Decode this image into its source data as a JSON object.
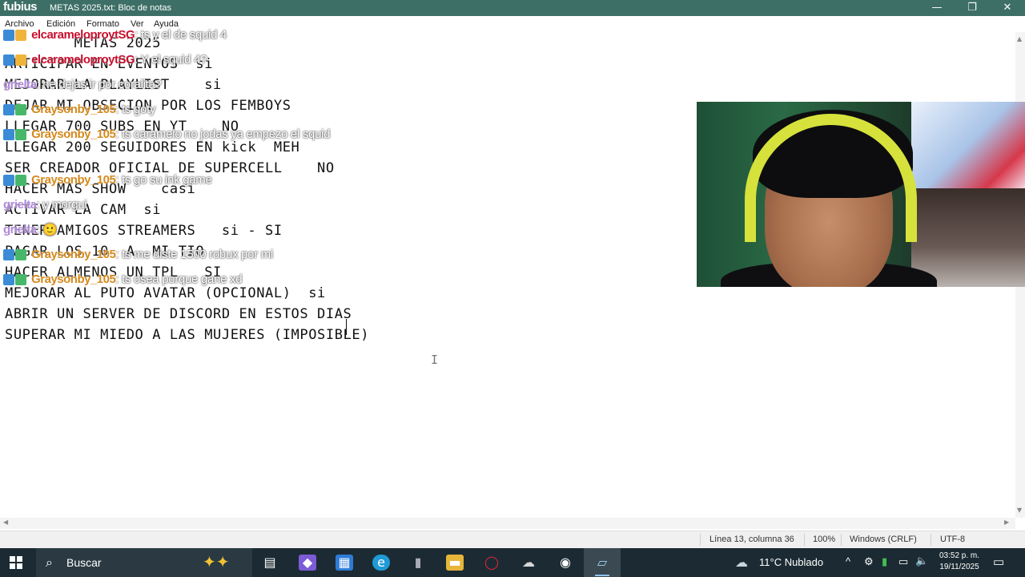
{
  "window": {
    "overlay_logo": "fubius",
    "title": "METAS 2025.txt: Bloc de notas",
    "controls": {
      "minimize": "—",
      "maximize": "❐",
      "close": "✕"
    }
  },
  "menu": [
    "Archivo",
    "Edición",
    "Formato",
    "Ver",
    "Ayuda"
  ],
  "document": {
    "lines": [
      "        METAS 2025",
      "ARTICIPAR EN EVENTOS  si",
      "MEJORAR LA PLAYLIST    si",
      "DEJAR MI OBSECION POR LOS FEMBOYS",
      "LLEGAR 700 SUBS EN YT    NO",
      "LLEGAR 200 SEGUIDORES EN kick  MEH",
      "SER CREADOR OFICIAL DE SUPERCELL    NO",
      "HACER MAS SHOW    casi",
      "ACTIVAR LA CAM  si",
      "TENER AMIGOS STREAMERS   si - SI",
      "PAGAR LOS 10  A  MI TIO",
      "HACER ALMENOS UN TPL   SI",
      "MEJORAR AL PUTO AVATAR (OPCIONAL)  si",
      "ABRIR UN SERVER DE DISCORD EN ESTOS DIAS",
      "SUPERAR MI MIEDO A LAS MUJERES (IMPOSIBLE)"
    ],
    "ibeam": "I"
  },
  "scroll": {
    "up": "▲",
    "down": "▼",
    "left": "◀",
    "right": "▶"
  },
  "status": {
    "position": "Línea 13, columna 36",
    "zoom": "100%",
    "line_ending": "Windows (CRLF)",
    "encoding": "UTF-8"
  },
  "chat": [
    {
      "user": "elcarameloproytSG",
      "msg": ": ts y el de squid 4",
      "color": "red"
    },
    {
      "user": "elcarameloproytSG",
      "msg": ": Y el squid 4?",
      "color": "red"
    },
    {
      "user": "grielta",
      "msg": ": ne dejas ir por coralita?",
      "color": "purple"
    },
    {
      "user": "Graysonby_105",
      "msg": ": ts goty",
      "color": "orange"
    },
    {
      "user": "Graysonby_105",
      "msg": ": ts caramelo no jodas ya empezo el squid",
      "color": "orange"
    },
    {
      "user": "Graysonby_105",
      "msg": ": ts go su ink game",
      "color": "orange"
    },
    {
      "user": "grielta",
      "msg": ": y morgui",
      "color": "purple"
    },
    {
      "user": "grielta",
      "msg": ": 🙂",
      "color": "purple"
    },
    {
      "user": "Graysonby_105",
      "msg": ": ts me diste 1500 robux por mi",
      "color": "orange"
    },
    {
      "user": "Graysonby_105",
      "msg": ": ts osea porque gane xd",
      "color": "orange"
    }
  ],
  "taskbar": {
    "search_placeholder": "Buscar",
    "weather": "11°C  Nublado",
    "time": "03:52 p. m.",
    "date": "19/11/2025"
  }
}
